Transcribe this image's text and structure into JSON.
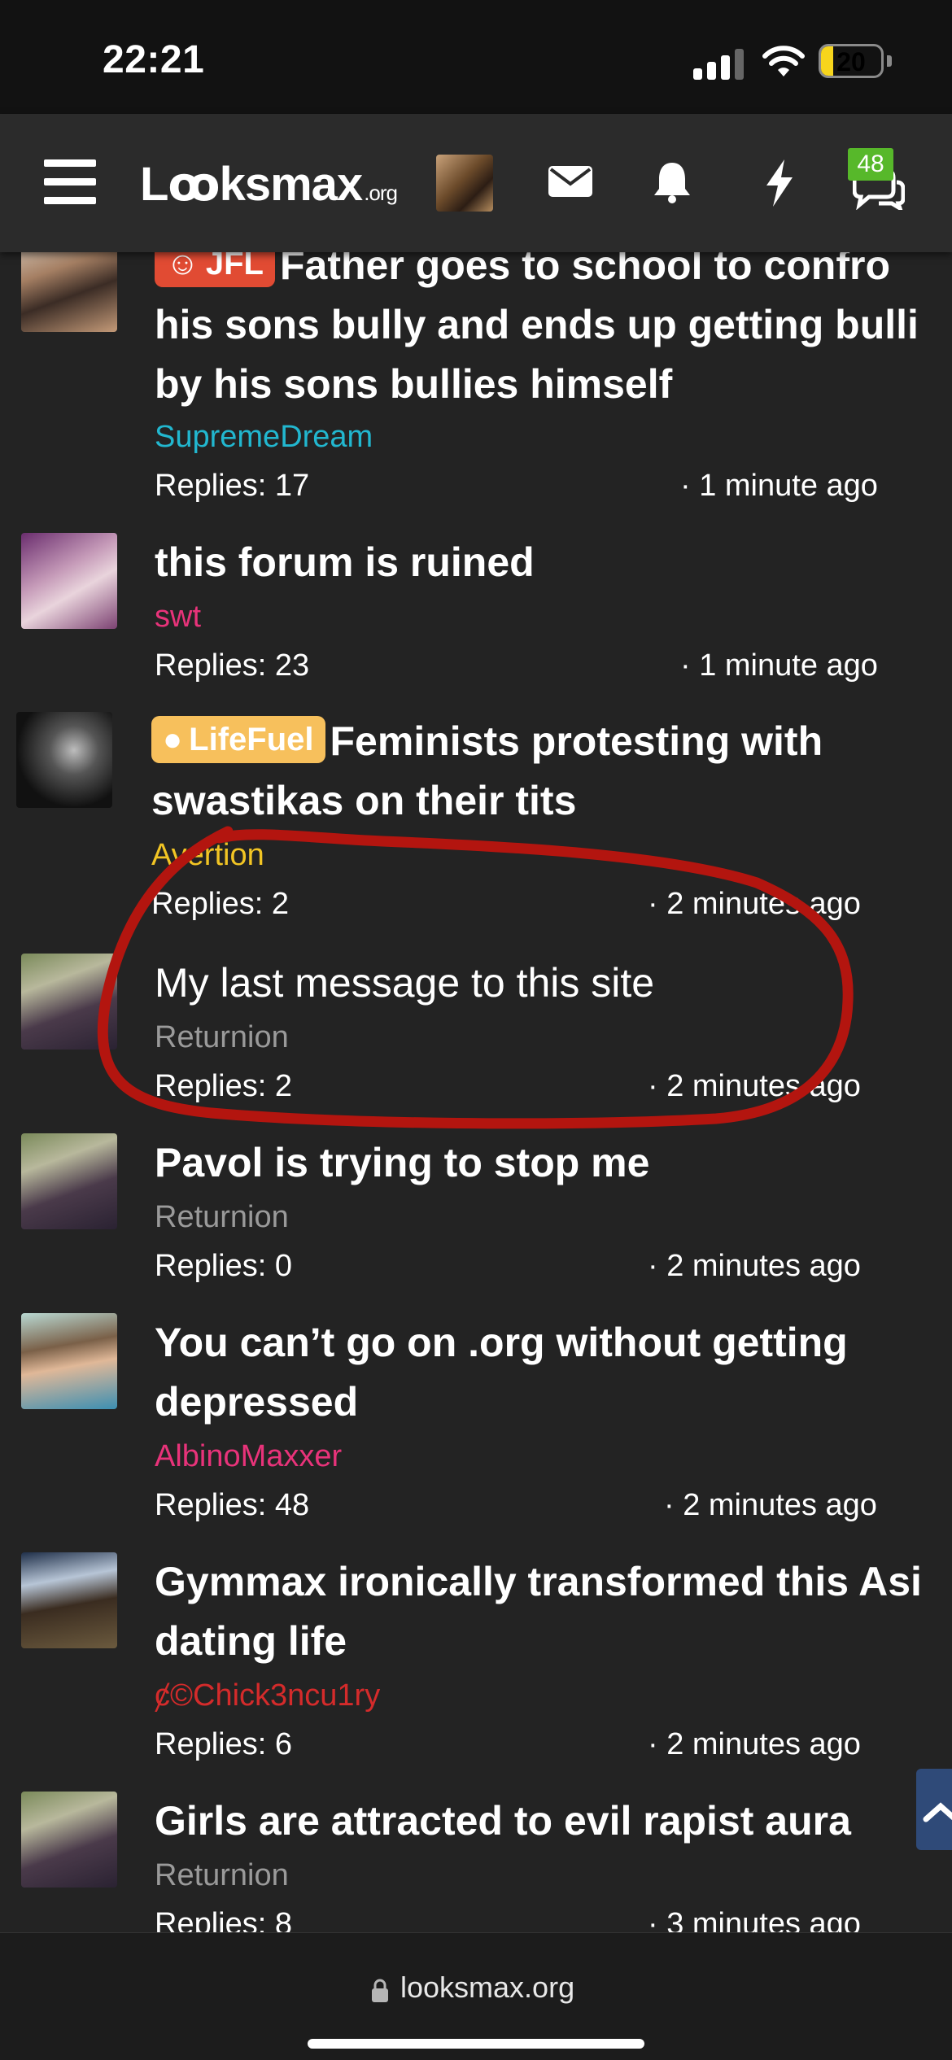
{
  "status_bar": {
    "time": "22:21",
    "battery": "20",
    "battery_level": 0.2
  },
  "header": {
    "logo": "Lꝏksmax",
    "logo_suffix": ".org",
    "notification_badge": "48"
  },
  "threads": [
    {
      "prefix": "JFL",
      "title_line1": "Father goes to school to confro",
      "title_line2": "his sons bully and ends up getting bulli",
      "title_line3": "by his sons bullies himself",
      "author": "SupremeDream",
      "replies": "Replies: 17",
      "time": "· 1 minute ago"
    },
    {
      "title_line1": "this forum is ruined",
      "author": "swt",
      "replies": "Replies: 23",
      "time": "· 1 minute ago"
    },
    {
      "prefix": "LifeFuel",
      "title_line1": "Feminists protesting with",
      "title_line2": "swastikas on their tits",
      "author": "Avertion",
      "replies": "Replies: 2",
      "time": "· 2 minutes ago"
    },
    {
      "title_line1": "My last message to this site",
      "author": "Returnion",
      "replies": "Replies: 2",
      "time": "· 2 minutes ago"
    },
    {
      "title_line1": "Pavol is trying to stop me",
      "author": "Returnion",
      "replies": "Replies: 0",
      "time": "· 2 minutes ago"
    },
    {
      "title_line1": "You can’t go on .org without getting",
      "title_line2": "depressed",
      "author": "AlbinoMaxxer",
      "replies": "Replies: 48",
      "time": "· 2 minutes ago"
    },
    {
      "title_line1": "Gymmax ironically transformed this Asi",
      "title_line2": "dating life",
      "author": "ȼ©Chick3ncu1ry",
      "replies": "Replies: 6",
      "time": "· 2 minutes ago"
    },
    {
      "title_line1": "Girls are attracted to evil rapist aura",
      "author": "Returnion",
      "replies": "Replies: 8",
      "time": "· 3 minutes ago"
    }
  ],
  "colors": {
    "background": "#232323",
    "header": "#2b2b2b",
    "author_cyan": "#22b7cf",
    "author_pink": "#e8337a",
    "author_yellow": "#f2c524",
    "author_grey": "#9a9a9a",
    "author_red": "#d42b2b",
    "annotation_red": "#b3150f"
  },
  "footer": {
    "url": "looksmax.org"
  }
}
